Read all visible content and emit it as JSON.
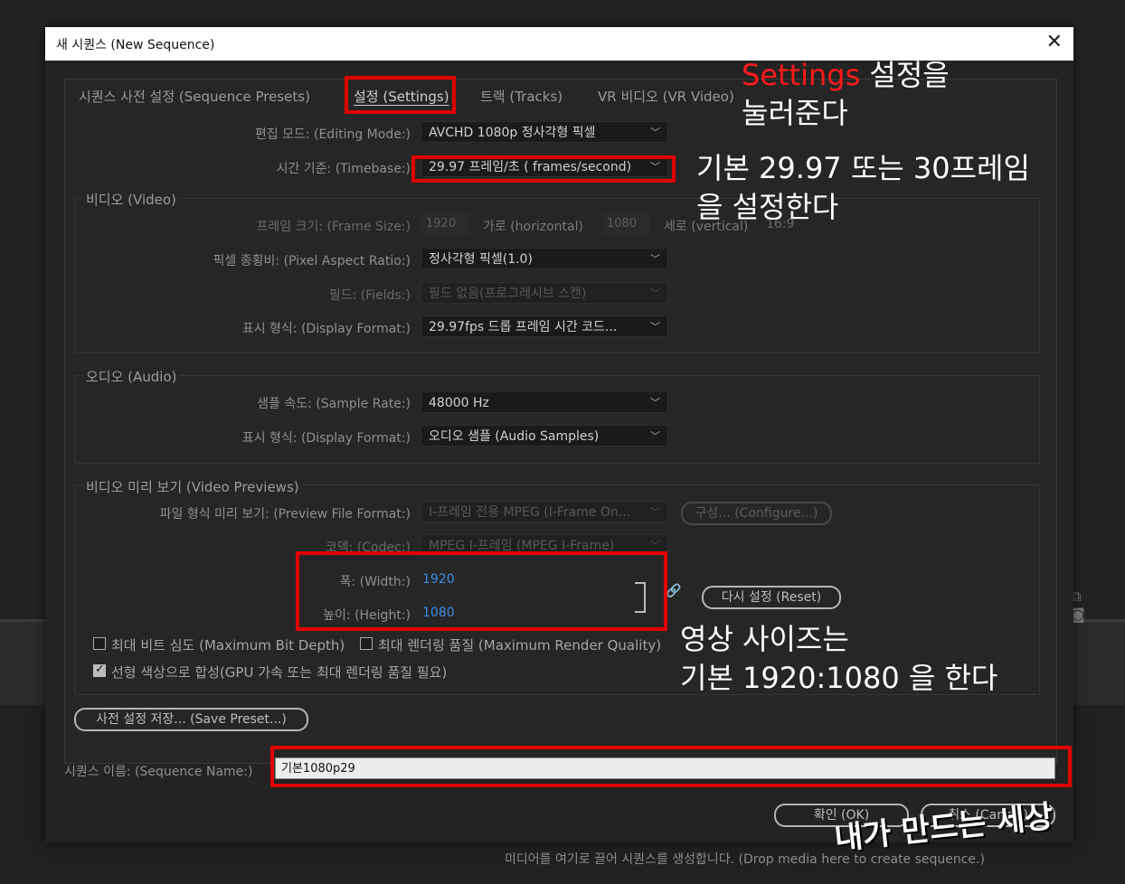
{
  "background": {
    "hint": "미디어를 여기로 끌어 시퀀스를 생성합니다. (Drop media here to create sequence.)",
    "icons": "⧉ ◙"
  },
  "dialog": {
    "title": "새 시퀀스 (New Sequence)",
    "close_icon": "✕",
    "tabs": [
      {
        "label": "시퀀스 사전 설정 (Sequence Presets)",
        "active": false
      },
      {
        "label": "설정 (Settings)",
        "active": true
      },
      {
        "label": "트랙 (Tracks)",
        "active": false
      },
      {
        "label": "VR 비디오 (VR Video)",
        "active": false
      }
    ],
    "editing_mode": {
      "label": "편집 모드: (Editing Mode:)",
      "value": "AVCHD 1080p 정사각형 픽셀"
    },
    "timebase": {
      "label": "시간 기준: (Timebase:)",
      "value": "29.97 프레임/초 ( frames/second)"
    },
    "video": {
      "title": "비디오 (Video)",
      "frame_size_label": "프레임 크기: (Frame Size:)",
      "frame_width": "1920",
      "horizontal_label": "가로 (horizontal)",
      "frame_height": "1080",
      "vertical_label": "세로 (vertical)",
      "aspect": "16:9",
      "pixel_aspect": {
        "label": "픽셀 종횡비: (Pixel Aspect Ratio:)",
        "value": "정사각형 픽셀(1.0)"
      },
      "fields": {
        "label": "필드: (Fields:)",
        "value": "필드 없음(프로그레시브 스캔)"
      },
      "display_format": {
        "label": "표시 형식: (Display Format:)",
        "value": "29.97fps 드롭 프레임 시간 코드..."
      }
    },
    "audio": {
      "title": "오디오 (Audio)",
      "sample_rate": {
        "label": "샘플 속도: (Sample Rate:)",
        "value": "48000 Hz"
      },
      "display_format": {
        "label": "표시 형식: (Display Format:)",
        "value": "오디오 샘플 (Audio Samples)"
      }
    },
    "previews": {
      "title": "비디오 미리 보기 (Video Previews)",
      "file_format": {
        "label": "파일 형식 미리 보기: (Preview File Format:)",
        "value": "I-프레임 전용 MPEG (I-Frame On..."
      },
      "configure_label": "구성... (Configure...)",
      "codec": {
        "label": "코덱: (Codec:)",
        "value": "MPEG I-프레임 (MPEG I-Frame)"
      },
      "width": {
        "label": "폭: (Width:)",
        "value": "1920"
      },
      "height": {
        "label": "높이: (Height:)",
        "value": "1080"
      },
      "link_icon": "🔗",
      "reset_label": "다시 설정 (Reset)"
    },
    "max_bit_depth": {
      "label": "최대 비트 심도 (Maximum Bit Depth)",
      "checked": false
    },
    "max_render_quality": {
      "label": "최대 렌더링 품질 (Maximum Render Quality)",
      "checked": false
    },
    "linear_color": {
      "label": "선형 색상으로 합성(GPU 가속 또는 최대 렌더링 품질 필요)",
      "checked": true
    },
    "save_preset_label": "사전 설정 저장... (Save Preset...)",
    "sequence_name": {
      "label": "시퀀스 이름: (Sequence Name:)",
      "value": "기본1080p29"
    },
    "ok_label": "확인 (OK)",
    "cancel_label": "취소 (Cancel)"
  },
  "annotations": {
    "settings_red": "Settings",
    "settings_rest": " 설정을",
    "settings_line2": "눌러준다",
    "timebase_line1": "기본 29.97 또는 30프레임",
    "timebase_line2": "을 설정한다",
    "size_line1": "영상 사이즈는",
    "size_line2": "기본 1920:1080 을 한다",
    "watermark": "내가 만드는 세상",
    "highlight_color": "#e10000"
  }
}
